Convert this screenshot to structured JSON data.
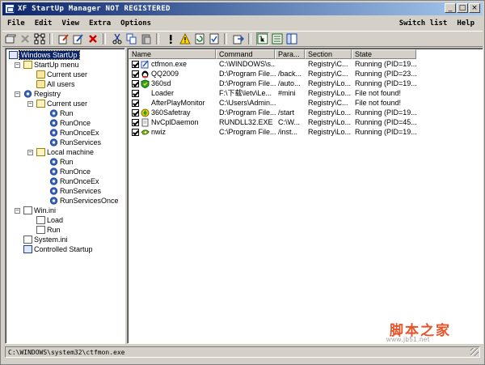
{
  "window": {
    "title": "XF StartUp Manager NOT REGISTERED",
    "controls": [
      "_",
      "□",
      "×"
    ]
  },
  "menu": {
    "left": [
      "File",
      "Edit",
      "View",
      "Extra",
      "Options"
    ],
    "right": [
      "Switch list",
      "Help"
    ]
  },
  "toolbar": {
    "icons": [
      "new-icon",
      "delete-gray-icon",
      "tree-icon",
      "edit-icon",
      "edit-note-icon",
      "delete-icon",
      "cut-icon",
      "copy-icon",
      "paste-icon",
      "exclamation-icon",
      "warning-icon",
      "refresh-icon",
      "check-document-icon",
      "export-icon",
      "view-tree-icon",
      "view-list-icon",
      "view-both-icon"
    ]
  },
  "tree": {
    "root": "Windows StartUp",
    "startup_menu": "StartUp menu",
    "current_user": "Current user",
    "all_users": "All users",
    "registry": "Registry",
    "reg_current_user": "Current user",
    "run": "Run",
    "runonce": "RunOnce",
    "runonceex": "RunOnceEx",
    "runservices": "RunServices",
    "local_machine": "Local machine",
    "lm_run": "Run",
    "lm_runonce": "RunOnce",
    "lm_runonceex": "RunOnceEx",
    "lm_runservices": "RunServices",
    "lm_runservicesonce": "RunServicesOnce",
    "win_ini": "Win.ini",
    "load": "Load",
    "win_run": "Run",
    "system_ini": "System.ini",
    "controlled_startup": "Controlled Startup"
  },
  "list": {
    "columns": [
      "Name",
      "Command",
      "Para...",
      "Section",
      "State"
    ],
    "rows": [
      {
        "name": "ctfmon.exe",
        "command": "C:\\WINDOWS\\s...",
        "params": "",
        "section": "Registry\\C...",
        "state": "Running (PID=19...",
        "icon": "ctfmon-icon"
      },
      {
        "name": "QQ2009",
        "command": "D:\\Program File...",
        "params": "/back...",
        "section": "Registry\\C...",
        "state": "Running (PID=23...",
        "icon": "qq-penguin-icon"
      },
      {
        "name": "360sd",
        "command": "D:\\Program File...",
        "params": "/auto...",
        "section": "Registry\\Lo...",
        "state": "Running (PID=19...",
        "icon": "shield-icon"
      },
      {
        "name": "Loader",
        "command": "F:\\下载\\letv\\Le...",
        "params": "#mini",
        "section": "Registry\\Lo...",
        "state": "File not found!",
        "icon": ""
      },
      {
        "name": "AfterPlayMonitor",
        "command": "C:\\Users\\Admin...",
        "params": "",
        "section": "Registry\\C...",
        "state": "File not found!",
        "icon": ""
      },
      {
        "name": "360Safetray",
        "command": "D:\\Program File...",
        "params": "/start",
        "section": "Registry\\Lo...",
        "state": "Running (PID=19...",
        "icon": "safe-guard-icon"
      },
      {
        "name": "NvCplDaemon",
        "command": "RUNDLL32.EXE",
        "params": "C:\\W...",
        "section": "Registry\\Lo...",
        "state": "Running (PID=45...",
        "icon": "file-icon"
      },
      {
        "name": "nwiz",
        "command": "C:\\Program File...",
        "params": "/inst...",
        "section": "Registry\\Lo...",
        "state": "Running (PID=19...",
        "icon": "nvidia-icon"
      }
    ]
  },
  "status": {
    "path": "C:\\WINDOWS\\system32\\ctfmon.exe"
  },
  "watermark": {
    "text": "脚本之家",
    "url": "www.jb51.net"
  }
}
